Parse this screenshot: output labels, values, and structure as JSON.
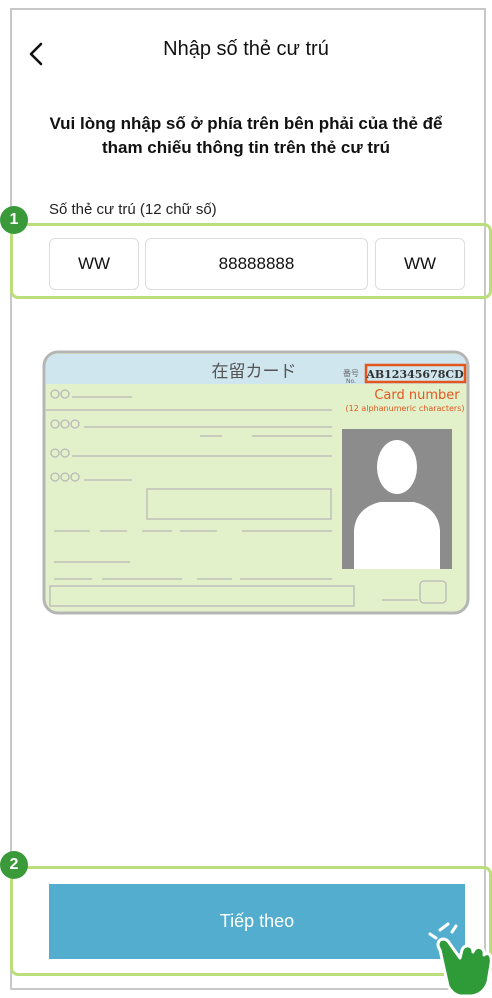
{
  "header": {
    "title": "Nhập số thẻ cư trú",
    "back_icon": "chevron-left-icon"
  },
  "instruction": "Vui lòng nhập số ở phía trên bên phải của thẻ để tham chiếu thông tin trên thẻ cư trú",
  "card_field": {
    "label": "Số thẻ cư trú (12 chữ số)",
    "segments": [
      "WW",
      "88888888",
      "WW"
    ]
  },
  "card_illustration": {
    "title_jp": "在留カード",
    "no_label": "番号",
    "no_sublabel": "No.",
    "sample_number": "AB12345678CD",
    "callout_title": "Card number",
    "callout_sub": "(12 alphanumeric characters)"
  },
  "annotations": {
    "step1": "1",
    "step2": "2"
  },
  "footer": {
    "next_label": "Tiếp theo"
  },
  "colors": {
    "button": "#53adcf",
    "highlight": "#b9de7a",
    "badge": "#3a9a3a",
    "card_bg": "#e2f1c9",
    "card_header": "#cfe6ef",
    "callout": "#e2571e"
  }
}
